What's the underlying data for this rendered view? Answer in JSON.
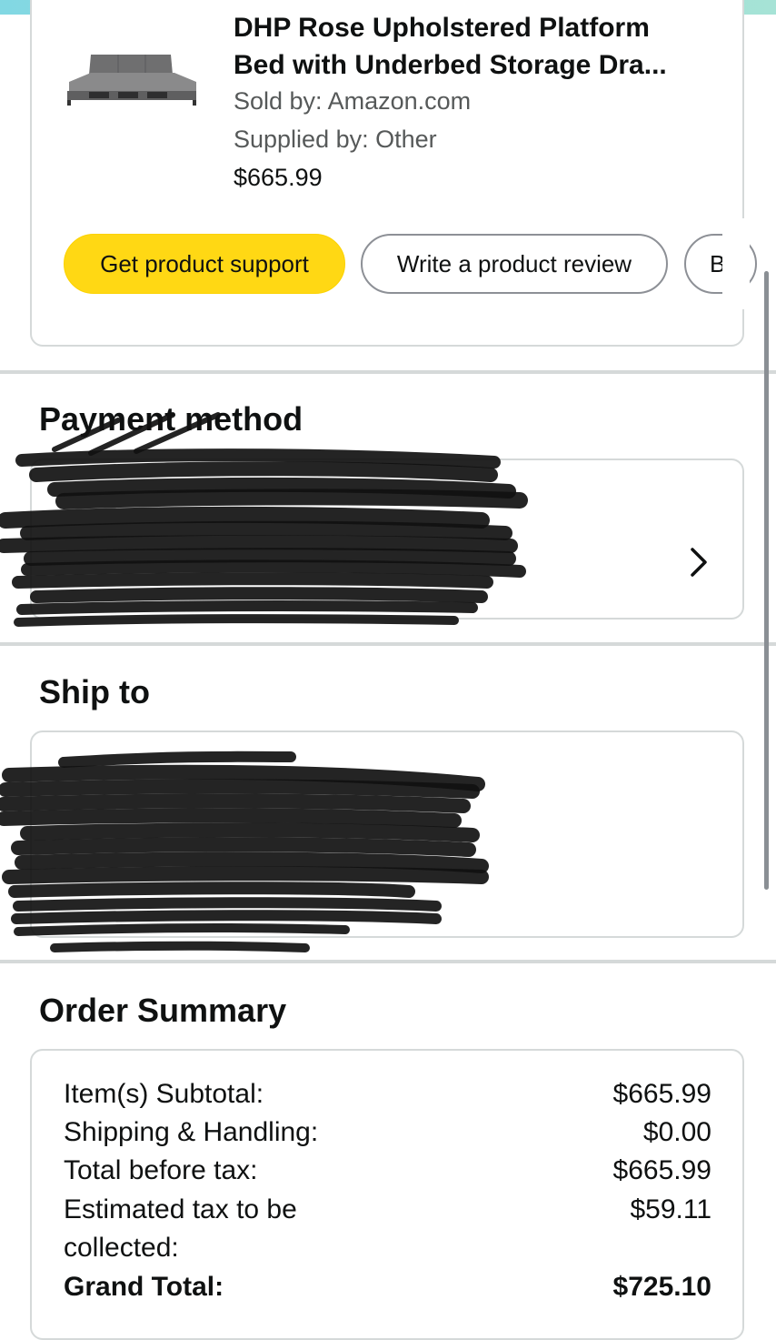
{
  "product": {
    "title_line1": "DHP Rose Upholstered Platform",
    "title_line2": "Bed with Underbed Storage Dra...",
    "sold_by": "Sold by: Amazon.com",
    "supplied_by": "Supplied by: Other",
    "price": "$665.99",
    "image_icon": "bed-image"
  },
  "actions": {
    "support_label": "Get product support",
    "review_label": "Write a product review",
    "more_label": "B"
  },
  "payment": {
    "title": "Payment method",
    "chevron_icon": "chevron-right-icon"
  },
  "ship_to": {
    "title": "Ship to"
  },
  "order_summary": {
    "title": "Order Summary",
    "rows": [
      {
        "label": "Item(s) Subtotal:",
        "value": "$665.99"
      },
      {
        "label": "Shipping & Handling:",
        "value": "$0.00"
      },
      {
        "label": "Total before tax:",
        "value": "$665.99"
      },
      {
        "label": "Estimated tax to be",
        "label2": "collected:",
        "value": "$59.11"
      },
      {
        "label": "Grand Total:",
        "value": "$725.10"
      }
    ]
  },
  "colors": {
    "primary_button": "#ffd814",
    "border": "#d5d9d9",
    "top_strip": "#82d8e3"
  }
}
